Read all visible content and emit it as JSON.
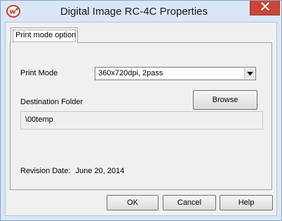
{
  "window": {
    "title": "Digital Image RC-4C Properties",
    "close_icon": "close-icon",
    "app_icon": "app-logo-icon"
  },
  "tabs": [
    {
      "label": "Print mode option",
      "selected": true
    }
  ],
  "print_mode": {
    "label": "Print Mode",
    "selected_value": "360x720dpi, 2pass"
  },
  "destination": {
    "label": "Destination Folder",
    "browse_label": "Browse",
    "value": "\\00temp"
  },
  "revision": {
    "label": "Revision Date:",
    "date": "June 20, 2014"
  },
  "footer": {
    "ok_label": "OK",
    "cancel_label": "Cancel",
    "help_label": "Help"
  },
  "colors": {
    "title_bar": "#d9e6f5",
    "close_button": "#c7463a",
    "dialog_background": "#f0f0f0"
  }
}
